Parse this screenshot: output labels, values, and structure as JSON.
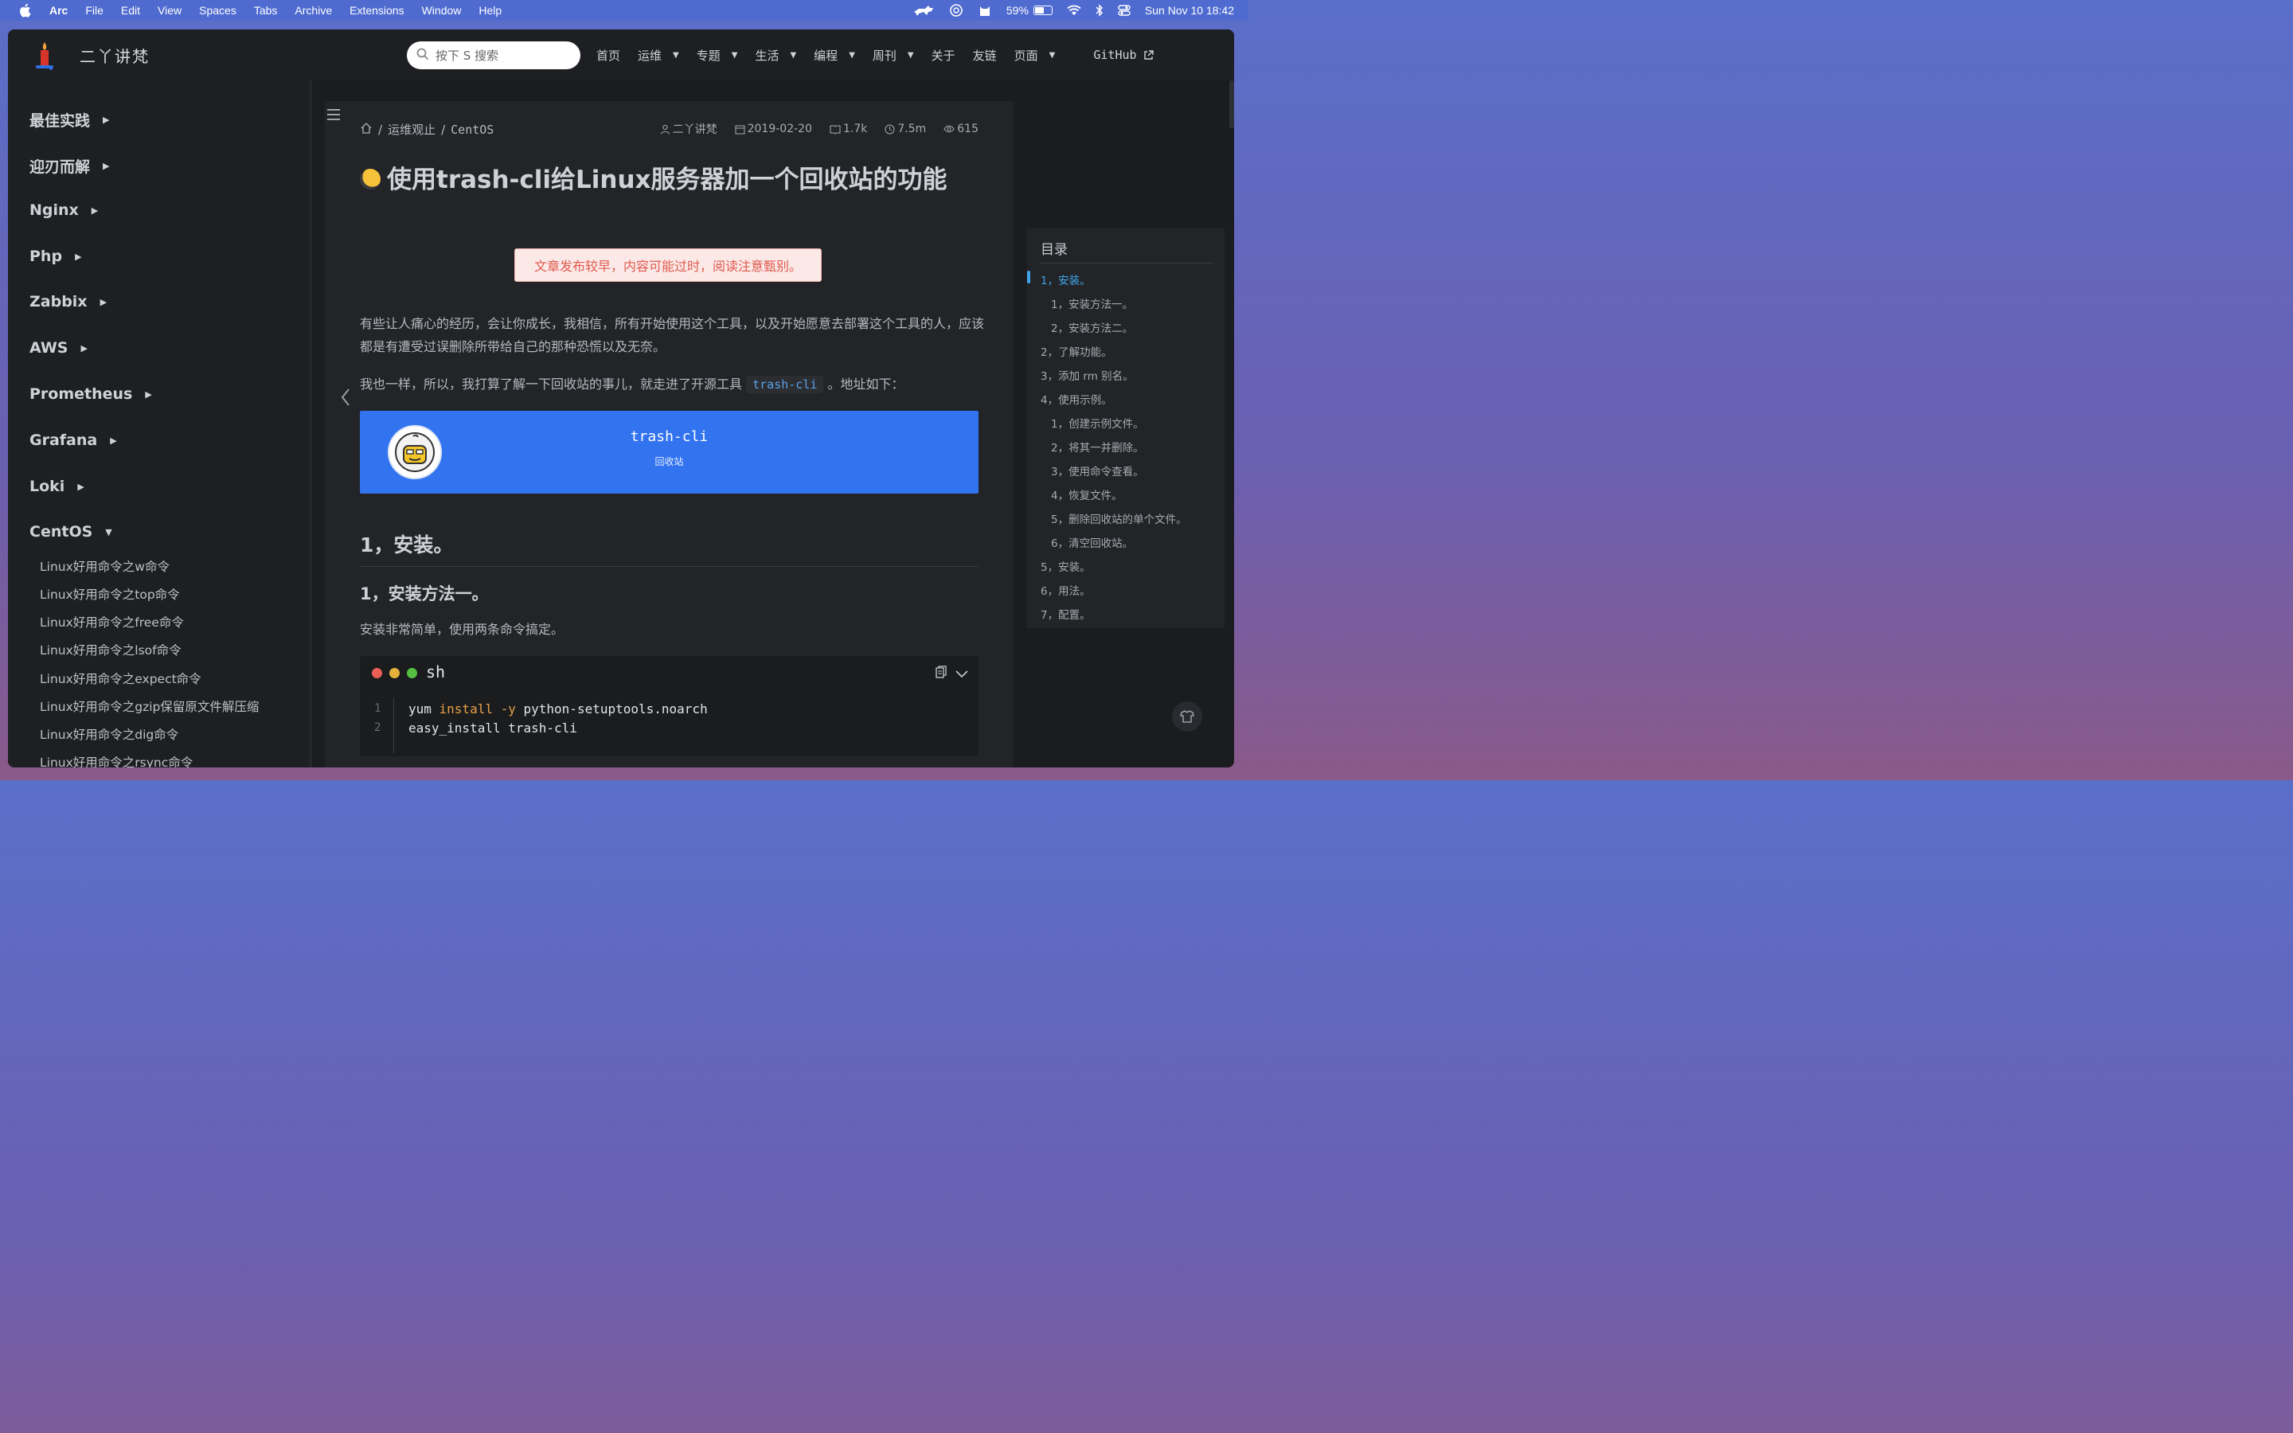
{
  "menubar": {
    "app": "Arc",
    "items": [
      "File",
      "Edit",
      "View",
      "Spaces",
      "Tabs",
      "Archive",
      "Extensions",
      "Window",
      "Help"
    ],
    "battery": "59%",
    "battery_level": 0.59,
    "datetime": "Sun Nov 10  18:42"
  },
  "site": {
    "title": "二丫讲梵",
    "search_placeholder": "按下 S 搜索"
  },
  "nav": {
    "items": [
      {
        "label": "首页",
        "dropdown": false
      },
      {
        "label": "运维",
        "dropdown": true
      },
      {
        "label": "专题",
        "dropdown": true
      },
      {
        "label": "生活",
        "dropdown": true
      },
      {
        "label": "编程",
        "dropdown": true
      },
      {
        "label": "周刊",
        "dropdown": true
      },
      {
        "label": "关于",
        "dropdown": false
      },
      {
        "label": "友链",
        "dropdown": false
      },
      {
        "label": "页面",
        "dropdown": true
      }
    ],
    "github": "GitHub"
  },
  "sidebar": {
    "sections": [
      "最佳实践",
      "迎刃而解",
      "Nginx",
      "Php",
      "Zabbix",
      "AWS",
      "Prometheus",
      "Grafana",
      "Loki",
      "CentOS"
    ],
    "centos_items": [
      "Linux好用命令之w命令",
      "Linux好用命令之top命令",
      "Linux好用命令之free命令",
      "Linux好用命令之lsof命令",
      "Linux好用命令之expect命令",
      "Linux好用命令之gzip保留原文件解压缩",
      "Linux好用命令之dig命令",
      "Linux好用命令之rsync命令"
    ]
  },
  "breadcrumb": [
    "运维观止",
    "CentOS"
  ],
  "meta": {
    "author": "二丫讲梵",
    "date": "2019-02-20",
    "words": "1.7k",
    "read_time": "7.5m",
    "views": "615"
  },
  "article": {
    "title": "使用trash-cli给Linux服务器加一个回收站的功能",
    "warning": "文章发布较早，内容可能过时，阅读注意甄别。",
    "para1": "有些让人痛心的经历，会让你成长，我相信，所有开始使用这个工具，以及开始愿意去部署这个工具的人，应该都是有遭受过误删除所带给自己的那种恐慌以及无奈。",
    "para2_before": "我也一样，所以，我打算了解一下回收站的事儿，就走进了开源工具",
    "para2_code": "trash-cli",
    "para2_after": "。地址如下：",
    "card_title": "trash-cli",
    "card_sub": "回收站",
    "h2": "1，安装。",
    "h3": "1，安装方法一。",
    "para3": "安装非常简单，使用两条命令搞定。",
    "code_lang": "sh",
    "code_lines": [
      {
        "num": "1",
        "cmd": "yum ",
        "kw": "install",
        "flag": " -y",
        "rest": " python-setuptools.noarch"
      },
      {
        "num": "2",
        "cmd": "easy_install trash-cli",
        "kw": "",
        "flag": "",
        "rest": ""
      }
    ]
  },
  "toc": {
    "title": "目录",
    "items": [
      {
        "label": "1，安装。",
        "level": 1,
        "active": true
      },
      {
        "label": "1，安装方法一。",
        "level": 2,
        "active": false
      },
      {
        "label": "2，安装方法二。",
        "level": 2,
        "active": false
      },
      {
        "label": "2，了解功能。",
        "level": 1,
        "active": false
      },
      {
        "label": "3，添加 rm 别名。",
        "level": 1,
        "active": false
      },
      {
        "label": "4，使用示例。",
        "level": 1,
        "active": false
      },
      {
        "label": "1，创建示例文件。",
        "level": 2,
        "active": false
      },
      {
        "label": "2，将其一并删除。",
        "level": 2,
        "active": false
      },
      {
        "label": "3，使用命令查看。",
        "level": 2,
        "active": false
      },
      {
        "label": "4，恢复文件。",
        "level": 2,
        "active": false
      },
      {
        "label": "5，删除回收站的单个文件。",
        "level": 2,
        "active": false
      },
      {
        "label": "6，清空回收站。",
        "level": 2,
        "active": false
      },
      {
        "label": "5，安装。",
        "level": 1,
        "active": false
      },
      {
        "label": "6，用法。",
        "level": 1,
        "active": false
      },
      {
        "label": "7，配置。",
        "level": 1,
        "active": false
      }
    ]
  },
  "colors": {
    "accent": "#3ea6e8",
    "card": "#3273f0",
    "warning_text": "#e05a4f"
  }
}
